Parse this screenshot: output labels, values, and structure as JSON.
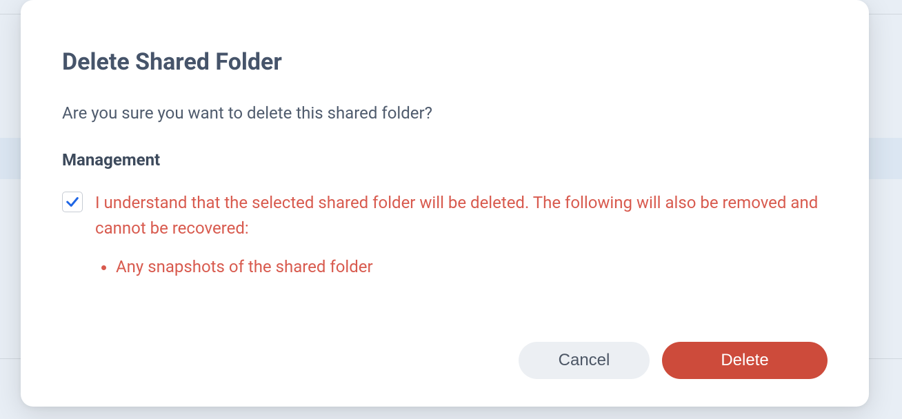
{
  "modal": {
    "title": "Delete Shared Folder",
    "prompt": "Are you sure you want to delete this shared folder?",
    "section_heading": "Management",
    "acknowledge": {
      "checked": true,
      "text": "I understand that the selected shared folder will be deleted. The following will also be removed and cannot be recovered:",
      "items": [
        "Any snapshots of the shared folder"
      ]
    },
    "buttons": {
      "cancel": "Cancel",
      "delete": "Delete"
    }
  }
}
